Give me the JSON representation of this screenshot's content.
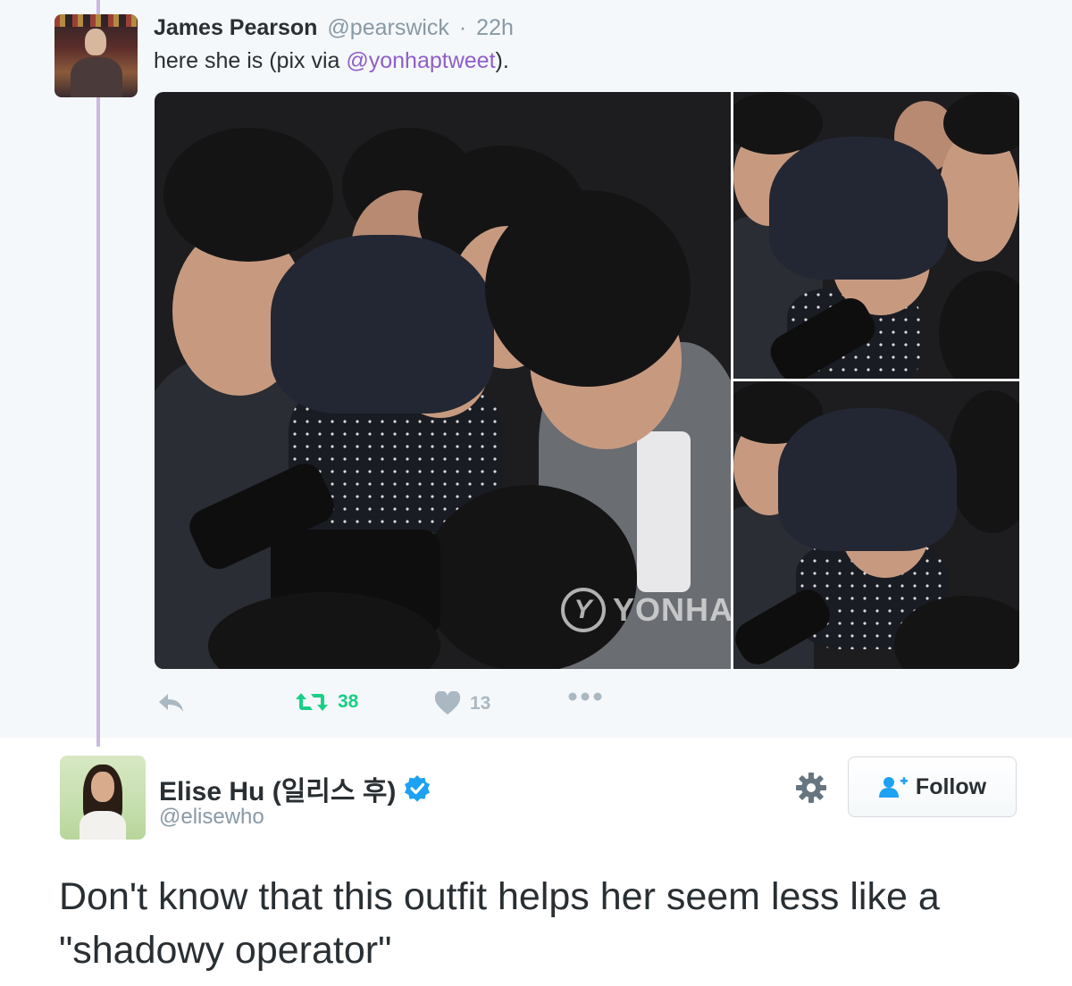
{
  "parent_tweet": {
    "author_name": "James Pearson",
    "handle": "@pearswick",
    "separator": "·",
    "time": "22h",
    "text_before": "here she is (pix via ",
    "mention": "@yonhaptweet",
    "text_after": ").",
    "watermark_text": "YONHA",
    "actions": {
      "retweet_count": "38",
      "like_count": "13"
    }
  },
  "main_tweet": {
    "author_name": "Elise Hu (일리스 후)",
    "handle": "@elisewho",
    "verified": true,
    "follow_label": "Follow",
    "text": "Don't know that this outfit helps her seem less like a \"shadowy operator\""
  },
  "colors": {
    "thread_line": "#c9b8e3",
    "mention": "#8e5fc9",
    "retweet_active": "#19cf86",
    "like": "#aab8c2",
    "verified": "#1da1f2",
    "follow_icon": "#1da1f2",
    "muted": "#8899a6"
  },
  "icons": [
    "reply-icon",
    "retweet-icon",
    "heart-icon",
    "more-icon",
    "verified-badge-icon",
    "gear-icon",
    "follow-person-icon"
  ]
}
